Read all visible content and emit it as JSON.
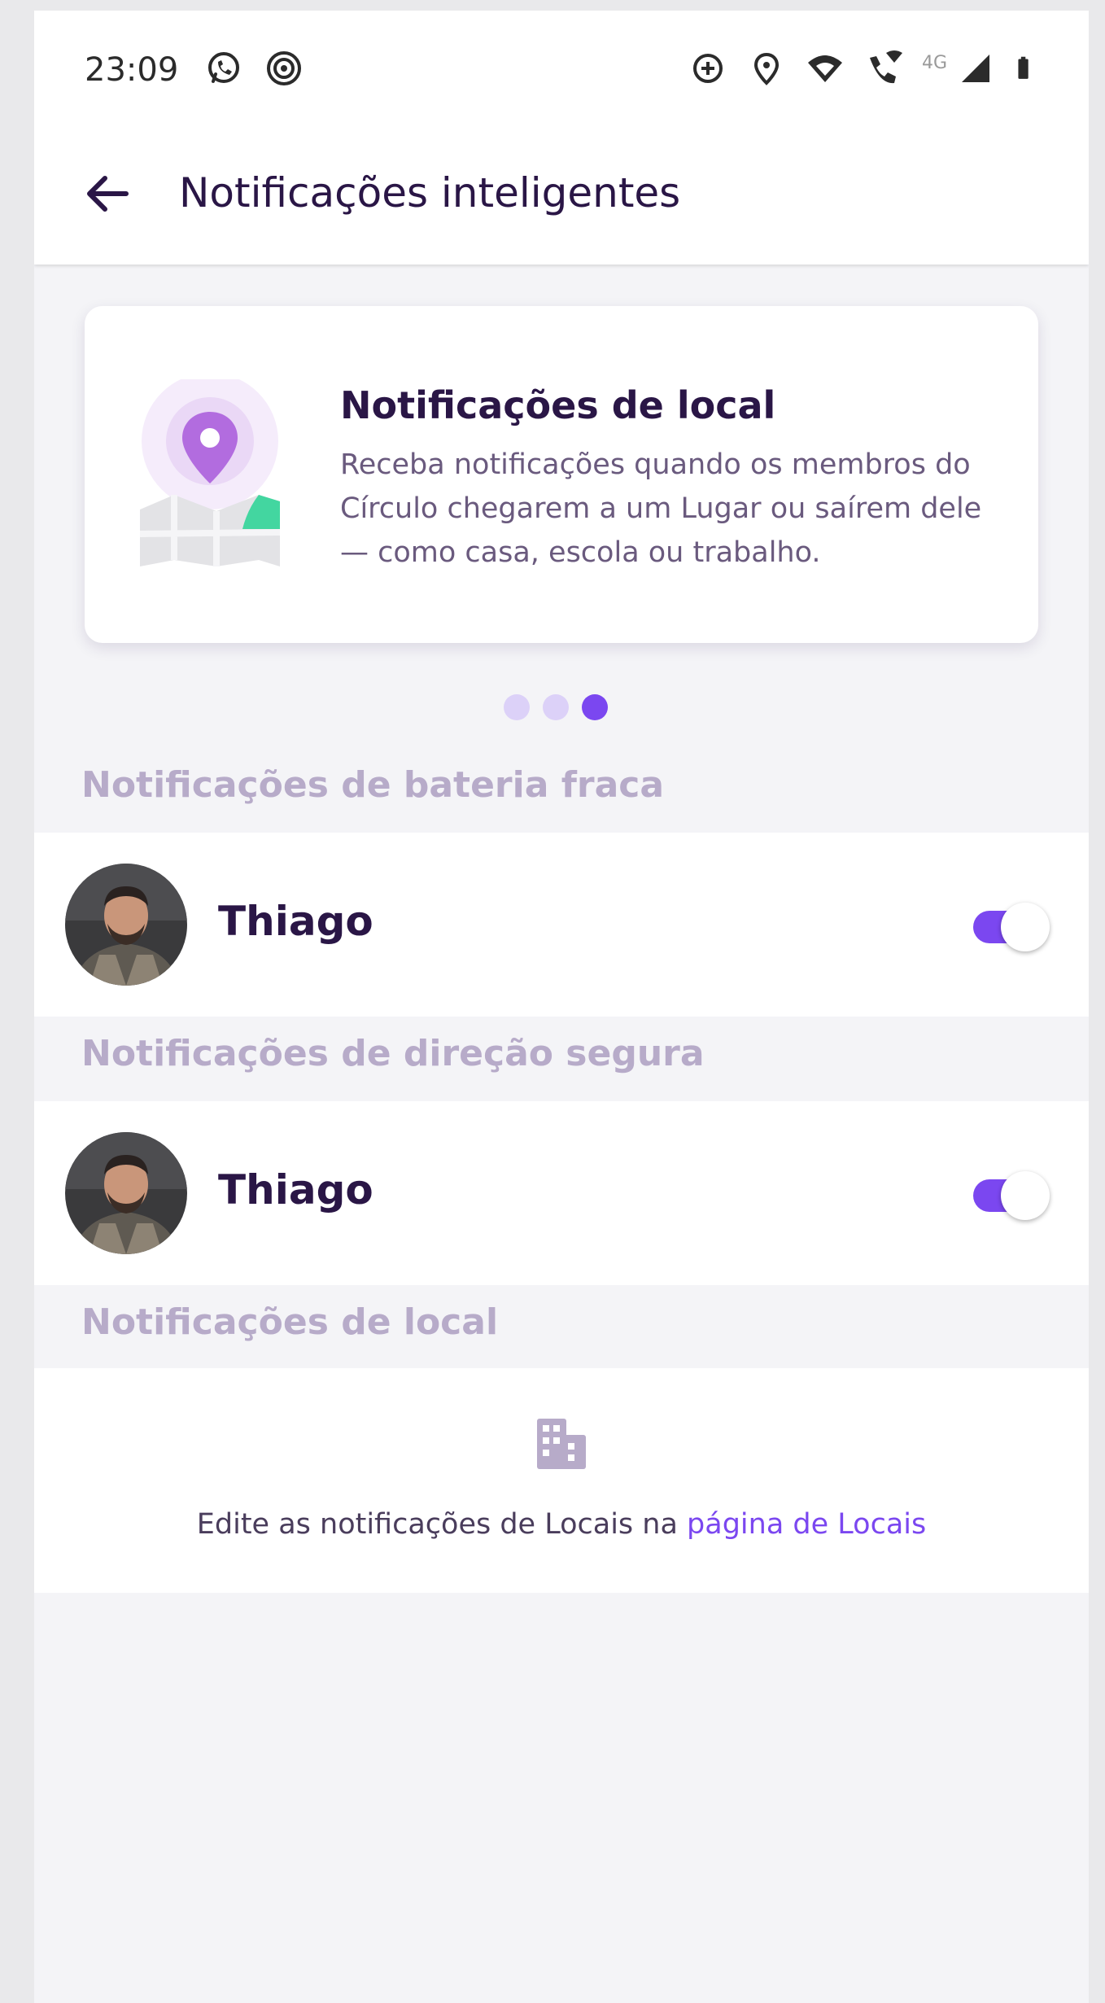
{
  "status_bar": {
    "time": "23:09",
    "network": "4G",
    "icons_left": [
      "whatsapp-icon",
      "signal-messenger-icon"
    ],
    "icons_right": [
      "data-saver-icon",
      "location-icon",
      "wifi-icon",
      "wifi-call-icon",
      "cell-signal-icon",
      "battery-icon"
    ]
  },
  "app_bar": {
    "title": "Notificações inteligentes"
  },
  "card": {
    "title": "Notificações de local",
    "body": "Receba notificações quando os membros do Círculo chegarem a um Lugar ou saírem dele — como casa, escola ou trabalho.",
    "page_count": 3,
    "active_index": 2
  },
  "sections": {
    "battery": {
      "label": "Notificações de bateria fraca",
      "member": {
        "name": "Thiago",
        "enabled": true
      }
    },
    "driving": {
      "label": "Notificações de direção segura",
      "member": {
        "name": "Thiago",
        "enabled": true
      }
    },
    "location": {
      "label": "Notificações de local",
      "text_prefix": "Edite as notificações de Locais na ",
      "link_text": "página de Locais"
    }
  },
  "colors": {
    "accent": "#7b47f0",
    "title_text": "#2a1646",
    "section_label": "#b7abc9",
    "background": "#f4f4f7"
  }
}
